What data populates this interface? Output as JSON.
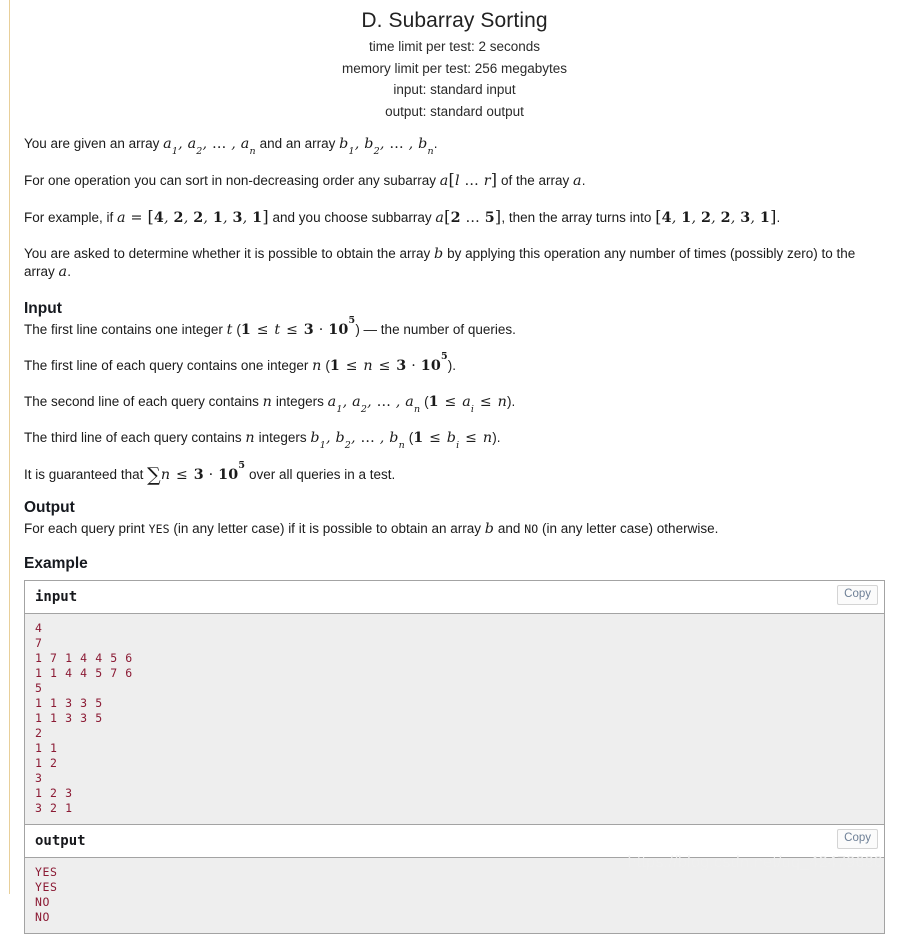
{
  "header": {
    "title": "D. Subarray Sorting",
    "time_limit": "time limit per test: 2 seconds",
    "memory_limit": "memory limit per test: 256 megabytes",
    "input_mode": "input: standard input",
    "output_mode": "output: standard output"
  },
  "statement": {
    "p1": {
      "t1": "You are given an array ",
      "m1": "a₁, a₂, … , aₙ",
      "t2": " and an array ",
      "m2": "b₁, b₂, … , bₙ",
      "t3": "."
    },
    "p2": {
      "t1": "For one operation you can sort in non-decreasing order any subarray ",
      "m1": "a[l … r]",
      "t2": " of the array ",
      "m2": "a",
      "t3": "."
    },
    "p3": {
      "t1": "For example, if ",
      "m1": "a = [4, 2, 2, 1, 3, 1]",
      "t2": " and you choose subbarray ",
      "m2": "a[2 … 5]",
      "t3": ", then the array turns into ",
      "m3": "[4, 1, 2, 2, 3, 1]",
      "t4": "."
    },
    "p4": {
      "t1": "You are asked to determine whether it is possible to obtain the array ",
      "m1": "b",
      "t2": " by applying this operation any number of times (possibly zero) to the array ",
      "m2": "a",
      "t3": "."
    }
  },
  "input_section": {
    "heading": "Input",
    "l1": {
      "t1": "The first line contains one integer ",
      "m1": "t",
      "t2": " (",
      "m2": "1 ≤ t ≤ 3 · 10⁵",
      "t3": ") — the number of queries."
    },
    "l2": {
      "t1": "The first line of each query contains one integer ",
      "m1": "n",
      "t2": " (",
      "m2": "1 ≤ n ≤ 3 · 10⁵",
      "t3": ")."
    },
    "l3": {
      "t1": "The second line of each query contains ",
      "m1": "n",
      "t2": " integers ",
      "m2": "a₁, a₂, … , aₙ",
      "t3": " (",
      "m3": "1 ≤ aᵢ ≤ n",
      "t4": ")."
    },
    "l4": {
      "t1": "The third line of each query contains ",
      "m1": "n",
      "t2": " integers ",
      "m2": "b₁, b₂, … , bₙ",
      "t3": " (",
      "m3": "1 ≤ bᵢ ≤ n",
      "t4": ")."
    },
    "l5": {
      "t1": "It is guaranteed that ",
      "m1": "∑ n ≤ 3 · 10⁵",
      "t2": " over all queries in a test."
    }
  },
  "output_section": {
    "heading": "Output",
    "l1": {
      "t1": "For each query print ",
      "code1": "YES",
      "t2": " (in any letter case) if it is possible to obtain an array ",
      "m1": "b",
      "t3": " and ",
      "code2": "NO",
      "t4": " (in any letter case) otherwise."
    }
  },
  "example_section": {
    "heading": "Example",
    "input_label": "input",
    "output_label": "output",
    "copy_label": "Copy",
    "input_data": "4\n7\n1 7 1 4 4 5 6\n1 1 4 4 5 7 6\n5\n1 1 3 3 5\n1 1 3 3 5\n2\n1 1\n1 2\n3\n1 2 3\n3 2 1",
    "output_data": "YES\nYES\nNO\nNO"
  },
  "watermark": "https://blog.csdn.net/qq_42479630",
  "colors": {
    "sample_text": "#8b1a34",
    "sample_bg": "#eeeeee",
    "copy_text": "#6d7f96",
    "border": "#a3a3a3",
    "left_rule": "#e8cf9a"
  }
}
